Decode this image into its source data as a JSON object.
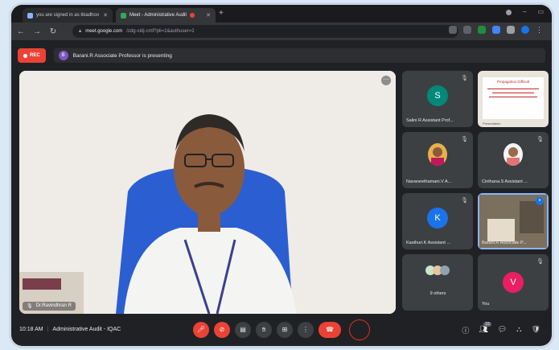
{
  "browser": {
    "tab1_title": "you are signed in as tikadhoo",
    "tab2_title": "Meet - Administrative Audit",
    "url_host": "meet.google.com",
    "url_path": "/zdg-xidj-cmf?pli=1&authuser=2"
  },
  "banner": {
    "rec_label": "REC",
    "presenter_initial": "B",
    "presenting_text": "Barani.R Associate Professor is presenting"
  },
  "main_video": {
    "speaker_name": "Dr.Ravindhran R"
  },
  "tiles": [
    {
      "name": "Salini R Assistant Prof...",
      "initial": "S",
      "color": "#00897b",
      "kind": "avatar"
    },
    {
      "name": "",
      "kind": "presentation",
      "slide_title": "Propagation Difficult",
      "slide_caption": "Presentation"
    },
    {
      "name": "Navaneethamani.V A...",
      "kind": "photo"
    },
    {
      "name": "Cinthana.S Assistant ...",
      "kind": "photo"
    },
    {
      "name": "Kasthuri.K Assistant ...",
      "initial": "K",
      "color": "#1a73e8",
      "kind": "avatar"
    },
    {
      "name": "Barani.R Associate P...",
      "kind": "video"
    },
    {
      "name": "9 others",
      "kind": "others"
    },
    {
      "name": "You",
      "initial": "V",
      "color": "#e91e63",
      "kind": "avatar"
    }
  ],
  "bottom": {
    "time": "10:18 AM",
    "meeting_name": "Administrative Audit - IQAC",
    "people_count": "15"
  },
  "colors": {
    "accent_red": "#ea4335",
    "bg": "#202124"
  }
}
